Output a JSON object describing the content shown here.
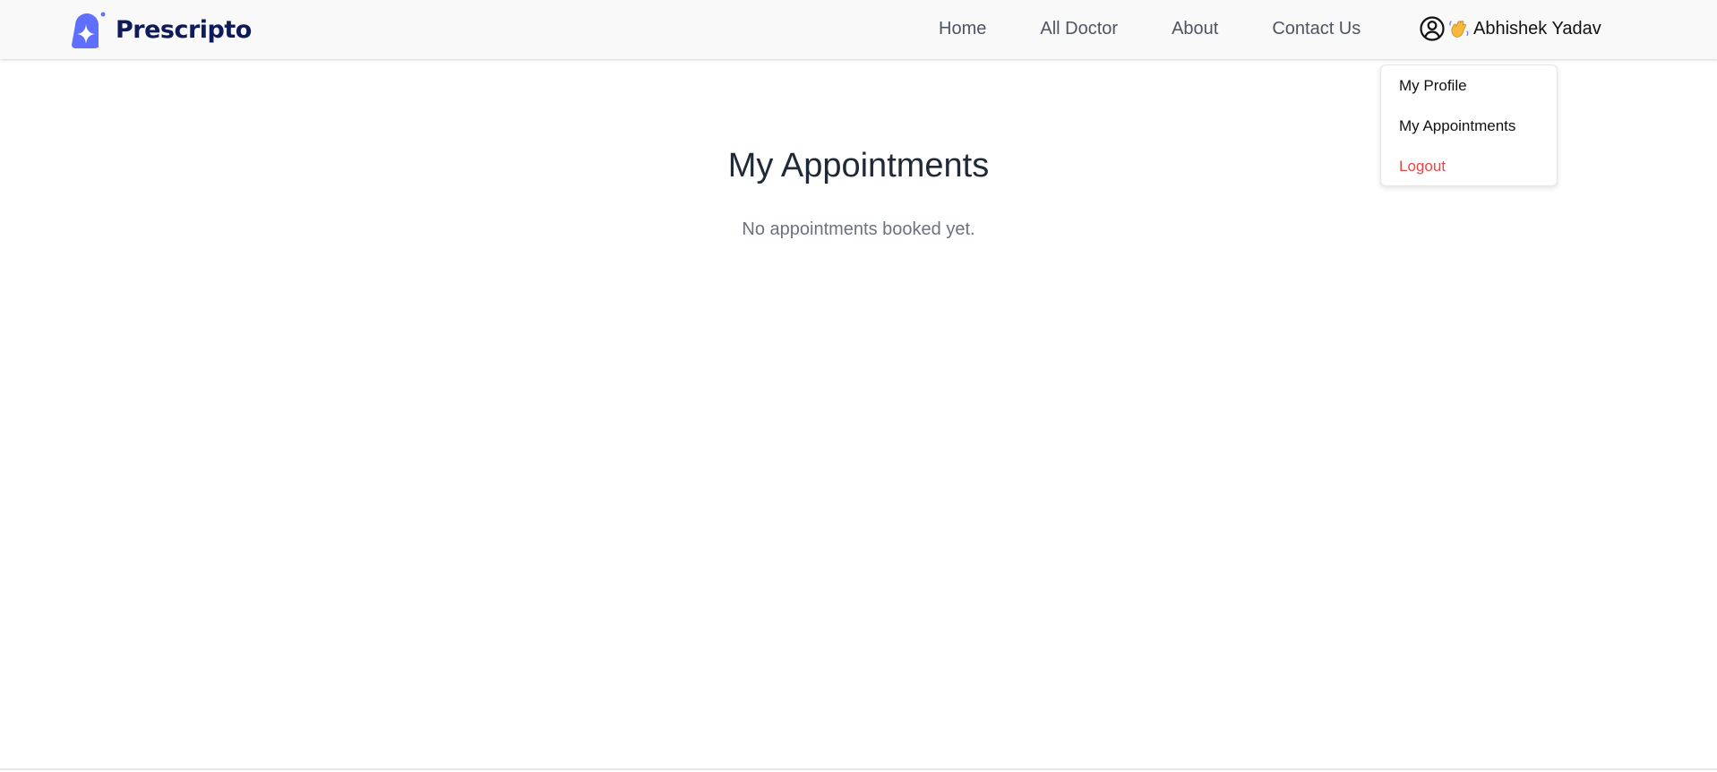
{
  "brand": {
    "name": "Prescripto",
    "logo_icon": "sparkle-logo-icon",
    "color": "#0f1a5a",
    "accent": "#5f6fff"
  },
  "nav": {
    "links": [
      "Home",
      "All Doctor",
      "About",
      "Contact Us"
    ]
  },
  "user": {
    "icon": "user-circle-icon",
    "greeting_icon": "waving-hand-icon",
    "name": "Abhishek Yadav"
  },
  "dropdown": {
    "items": [
      {
        "label": "My Profile"
      },
      {
        "label": "My Appointments"
      },
      {
        "label": "Logout",
        "color": "#ef4444"
      }
    ]
  },
  "main": {
    "title": "My Appointments",
    "empty_message": "No appointments booked yet."
  }
}
